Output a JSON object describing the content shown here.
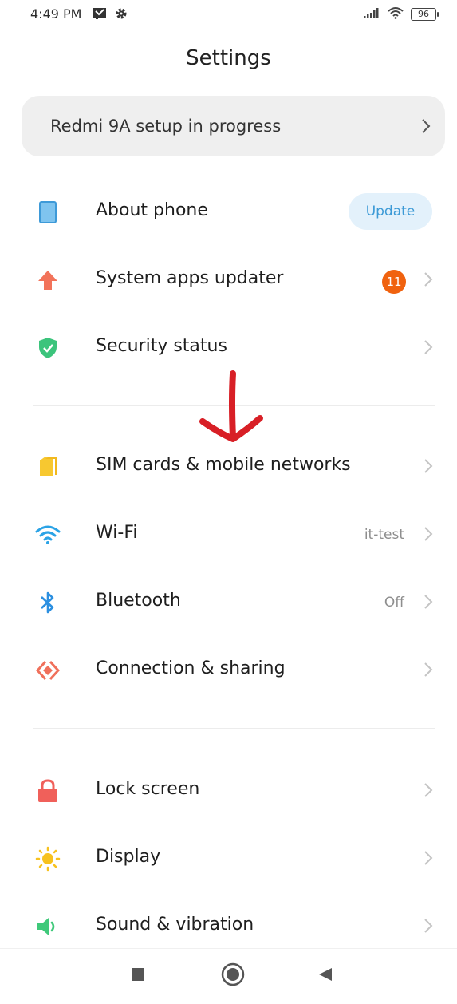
{
  "status_bar": {
    "time": "4:49 PM",
    "left_icons": [
      "message-icon",
      "gear-icon"
    ],
    "right_icons": [
      "signal-icon",
      "wifi-icon",
      "battery-icon"
    ],
    "battery_level": "96"
  },
  "header": {
    "title": "Settings"
  },
  "setup_banner": {
    "text": "Redmi 9A setup in progress"
  },
  "sections": [
    {
      "items": [
        {
          "label": "About phone",
          "icon": "phone-icon",
          "action_label": "Update"
        },
        {
          "label": "System apps updater",
          "icon": "arrow-up-icon",
          "badge": "11"
        },
        {
          "label": "Security status",
          "icon": "shield-check-icon"
        }
      ]
    },
    {
      "items": [
        {
          "label": "SIM cards & mobile networks",
          "icon": "sim-card-icon"
        },
        {
          "label": "Wi-Fi",
          "icon": "wifi-icon",
          "value": "it-test"
        },
        {
          "label": "Bluetooth",
          "icon": "bluetooth-icon",
          "value": "Off"
        },
        {
          "label": "Connection & sharing",
          "icon": "connection-sharing-icon"
        }
      ]
    },
    {
      "items": [
        {
          "label": "Lock screen",
          "icon": "lock-icon"
        },
        {
          "label": "Display",
          "icon": "sun-icon"
        },
        {
          "label": "Sound & vibration",
          "icon": "speaker-icon"
        }
      ]
    }
  ],
  "annotation": {
    "icon": "red-arrow-down-icon",
    "color": "#d81f26"
  },
  "nav_bar": {
    "buttons": [
      "recents-square-icon",
      "home-circle-icon",
      "back-triangle-icon"
    ]
  },
  "colors": {
    "update_pill_bg": "#e3f1fb",
    "update_pill_text": "#3c9ad6",
    "badge": "#f0620f",
    "banner_bg": "#efefef"
  }
}
